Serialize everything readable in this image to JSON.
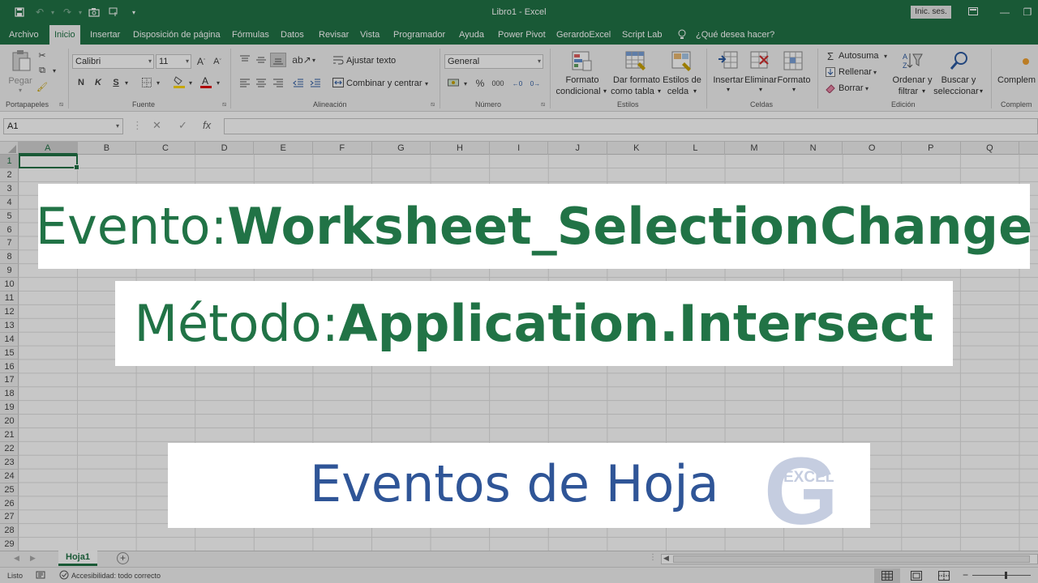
{
  "titlebar": {
    "title": "Libro1 - Excel",
    "signin_label": "Inic. ses.",
    "quick_access": [
      "save-icon",
      "undo-icon",
      "redo-icon",
      "camera-icon",
      "touch-mode-icon",
      "customize-icon"
    ]
  },
  "tabs": [
    "Archivo",
    "Inicio",
    "Insertar",
    "Disposición de página",
    "Fórmulas",
    "Datos",
    "Revisar",
    "Vista",
    "Programador",
    "Ayuda",
    "Power Pivot",
    "GerardoExcel",
    "Script Lab"
  ],
  "active_tab": "Inicio",
  "tell_me": "¿Qué desea hacer?",
  "ribbon": {
    "clipboard": {
      "paste": "Pegar",
      "label": "Portapapeles"
    },
    "font": {
      "name": "Calibri",
      "size": "11",
      "bold": "N",
      "italic": "K",
      "underline": "S",
      "label": "Fuente"
    },
    "alignment": {
      "wrap": "Ajustar texto",
      "merge": "Combinar y centrar",
      "label": "Alineación"
    },
    "number": {
      "format": "General",
      "percent": "%",
      "thousands": "000",
      "label": "Número"
    },
    "styles": {
      "conditional_1": "Formato",
      "conditional_2": "condicional",
      "table_1": "Dar formato",
      "table_2": "como tabla",
      "cell_1": "Estilos de",
      "cell_2": "celda",
      "label": "Estilos"
    },
    "cells": {
      "insert": "Insertar",
      "delete": "Eliminar",
      "format": "Formato",
      "label": "Celdas"
    },
    "editing": {
      "autosum": "Autosuma",
      "fill": "Rellenar",
      "clear": "Borrar",
      "sort_1": "Ordenar y",
      "sort_2": "filtrar",
      "find_1": "Buscar y",
      "find_2": "seleccionar",
      "label": "Edición"
    },
    "addins": {
      "button": "Complem",
      "label": "Complem"
    }
  },
  "formula_bar": {
    "name_box": "A1",
    "cancel": "✕",
    "enter": "✓",
    "fx": "fx",
    "value": ""
  },
  "grid": {
    "columns": [
      "A",
      "B",
      "C",
      "D",
      "E",
      "F",
      "G",
      "H",
      "I",
      "J",
      "K",
      "L",
      "M",
      "N",
      "O",
      "P",
      "Q"
    ],
    "rows": [
      "1",
      "2",
      "3",
      "4",
      "5",
      "6",
      "7",
      "8",
      "9",
      "10",
      "11",
      "12",
      "13",
      "14",
      "15",
      "16",
      "17",
      "18",
      "19",
      "20",
      "21",
      "22",
      "23",
      "24",
      "25",
      "26",
      "27",
      "28",
      "29"
    ],
    "active_cell": "A1"
  },
  "banners": {
    "line1_prefix": "Evento: ",
    "line1_bold": "Worksheet_SelectionChange",
    "line2_prefix": "Método: ",
    "line2_bold": "Application.Intersect",
    "line3": "Eventos de Hoja",
    "logo_text": "EXCEL",
    "logo_letter": "G",
    "colors": {
      "green": "#217346",
      "blue": "#2f5597",
      "logo": "#c5cde0"
    }
  },
  "sheets": [
    "Hoja1"
  ],
  "statusbar": {
    "ready": "Listo",
    "accessibility": "Accesibilidad: todo correcto"
  }
}
